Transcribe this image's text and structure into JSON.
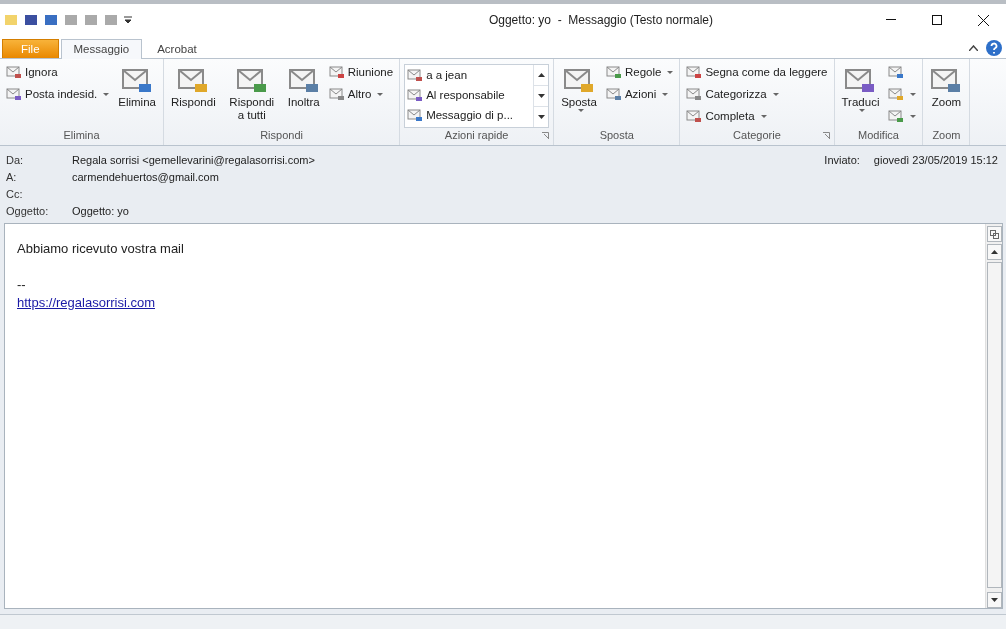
{
  "window": {
    "title": "Oggetto: yo  -  Messaggio (Testo normale)"
  },
  "tabs": [
    {
      "label": "File",
      "kind": "file",
      "selected": false
    },
    {
      "label": "Messaggio",
      "kind": "tab",
      "selected": true
    },
    {
      "label": "Acrobat",
      "kind": "tab",
      "selected": false
    }
  ],
  "ribbon": {
    "groups": [
      {
        "label": "Elimina",
        "launcher": false,
        "columns": [
          {
            "kind": "stack",
            "buttons": [
              {
                "label": "Ignora",
                "dropdown": false
              },
              {
                "label": "Posta indesid.",
                "dropdown": true
              }
            ]
          },
          {
            "kind": "large",
            "buttons": [
              {
                "label": "Elimina",
                "dropdown": false
              }
            ]
          }
        ]
      },
      {
        "label": "Rispondi",
        "launcher": false,
        "columns": [
          {
            "kind": "large",
            "buttons": [
              {
                "label": "Rispondi",
                "dropdown": false
              },
              {
                "label": "Rispondi a tutti",
                "dropdown": false
              },
              {
                "label": "Inoltra",
                "dropdown": false
              }
            ]
          },
          {
            "kind": "stack",
            "buttons": [
              {
                "label": "Riunione",
                "dropdown": false
              },
              {
                "label": "Altro",
                "dropdown": true
              }
            ]
          }
        ]
      },
      {
        "label": "Azioni rapide",
        "launcher": true,
        "columns": [
          {
            "kind": "gallery",
            "buttons": [
              {
                "label": "a a jean"
              },
              {
                "label": "Al responsabile"
              },
              {
                "label": "Messaggio di p..."
              }
            ]
          }
        ]
      },
      {
        "label": "Sposta",
        "launcher": false,
        "columns": [
          {
            "kind": "large",
            "buttons": [
              {
                "label": "Sposta",
                "dropdown": true
              }
            ]
          },
          {
            "kind": "stack",
            "buttons": [
              {
                "label": "Regole",
                "dropdown": true
              },
              {
                "label": "Azioni",
                "dropdown": true
              }
            ]
          }
        ]
      },
      {
        "label": "Categorie",
        "launcher": true,
        "columns": [
          {
            "kind": "stack",
            "buttons": [
              {
                "label": "Segna come da leggere",
                "dropdown": false
              },
              {
                "label": "Categorizza",
                "dropdown": true
              },
              {
                "label": "Completa",
                "dropdown": true
              }
            ]
          }
        ]
      },
      {
        "label": "Modifica",
        "launcher": false,
        "columns": [
          {
            "kind": "large",
            "buttons": [
              {
                "label": "Traduci",
                "dropdown": true
              }
            ]
          },
          {
            "kind": "stack",
            "buttons": [
              {
                "dropdown": false
              },
              {
                "dropdown": true
              },
              {
                "dropdown": true
              }
            ]
          }
        ]
      },
      {
        "label": "Zoom",
        "launcher": false,
        "columns": [
          {
            "kind": "large",
            "buttons": [
              {
                "label": "Zoom",
                "dropdown": false
              }
            ]
          }
        ]
      }
    ]
  },
  "header": {
    "fields": [
      {
        "label": "Da:",
        "value": "Regala sorrisi <gemellevarini@regalasorrisi.com>"
      },
      {
        "label": "A:",
        "value": "carmendehuertos@gmail.com"
      },
      {
        "label": "Cc:"
      },
      {
        "label": "Oggetto:",
        "value": "Oggetto: yo"
      }
    ],
    "sent": {
      "label": "Inviato:",
      "value": "giovedì 23/05/2019 15:12"
    }
  },
  "body": {
    "lines": [
      {
        "kind": "text",
        "text": "Abbiamo ricevuto vostra mail"
      },
      {
        "kind": "blank"
      },
      {
        "kind": "text",
        "text": "--"
      },
      {
        "kind": "link",
        "text": "https://regalasorrisi.com"
      }
    ]
  }
}
